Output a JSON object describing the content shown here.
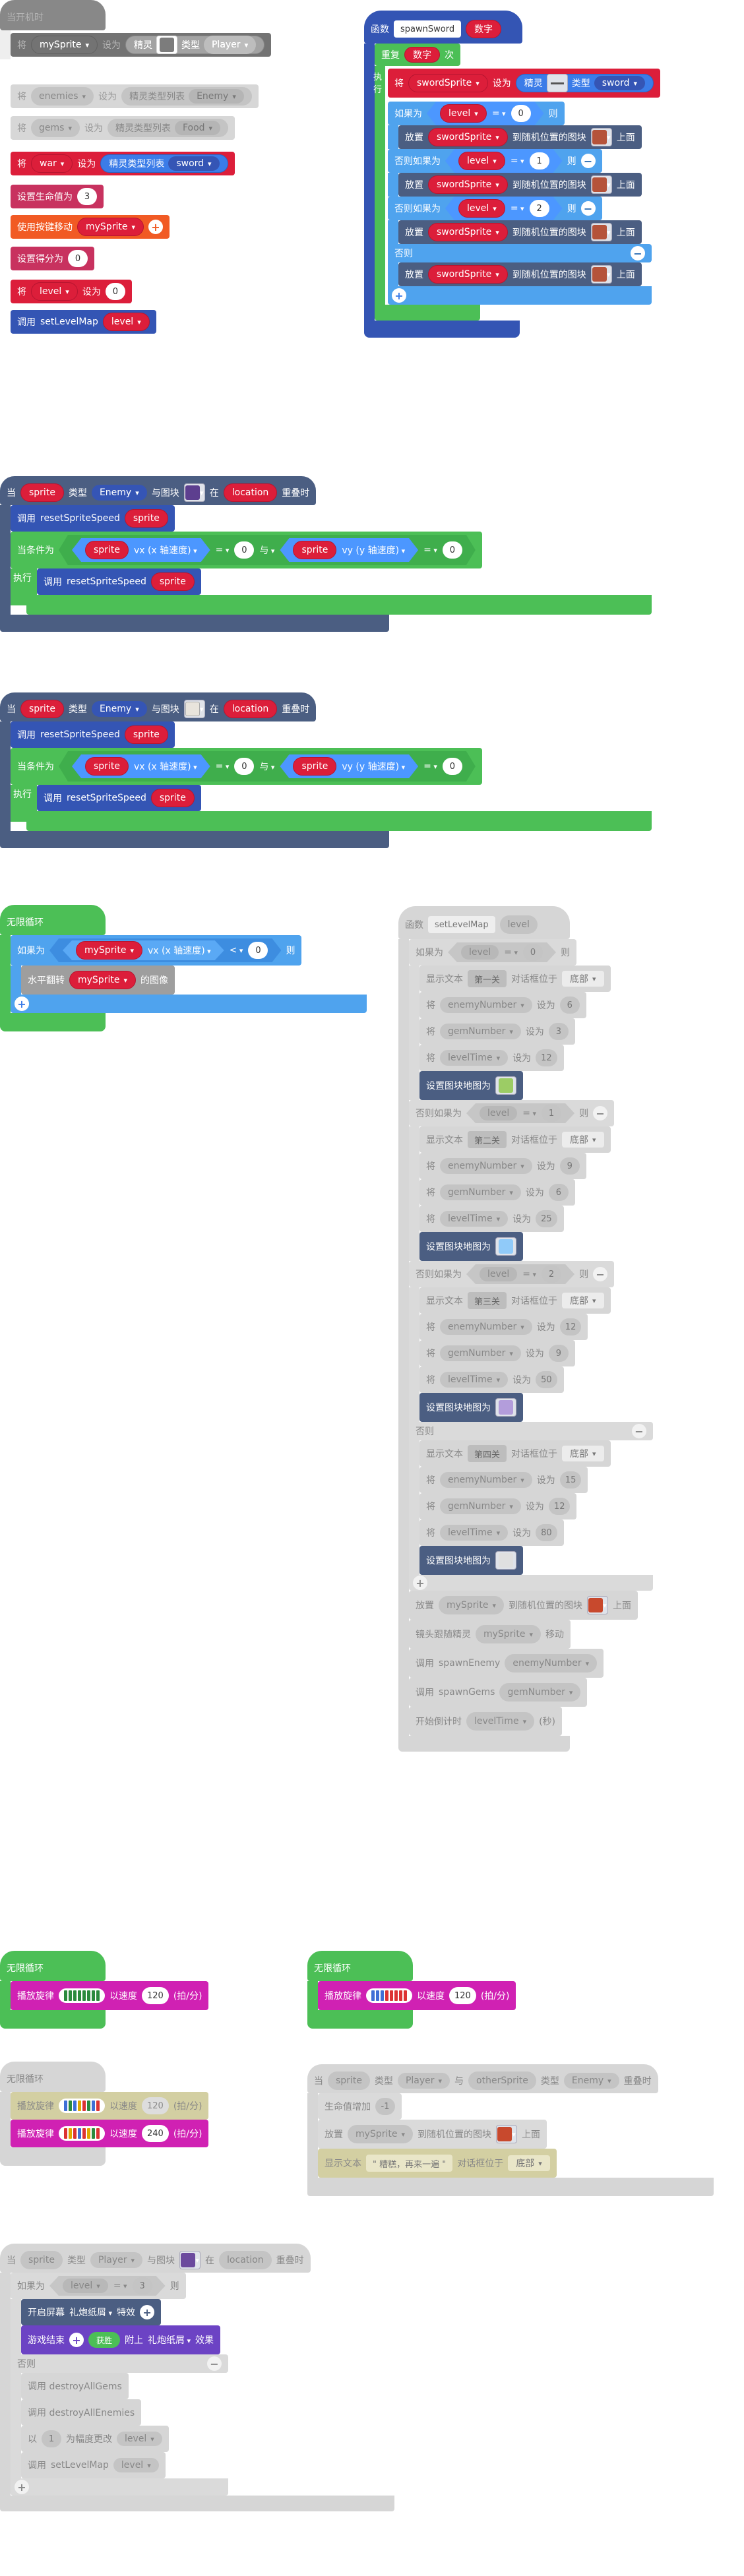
{
  "on_start": {
    "hat": "当开机时",
    "b1": {
      "set": "将",
      "var": "mySprite",
      "to": "设为",
      "sprite": "精灵",
      "type_lbl": "类型",
      "kind": "Player"
    },
    "b2": {
      "set": "将",
      "var": "enemies",
      "to": "设为",
      "list": "精灵类型列表",
      "kind": "Enemy"
    },
    "b3": {
      "set": "将",
      "var": "gems",
      "to": "设为",
      "list": "精灵类型列表",
      "kind": "Food"
    },
    "b4": {
      "set": "将",
      "var": "war",
      "to": "设为",
      "list": "精灵类型列表",
      "kind": "sword"
    },
    "b5": {
      "label": "设置生命值为",
      "value": "3"
    },
    "b6": {
      "label": "使用按键移动",
      "var": "mySprite"
    },
    "b7": {
      "label": "设置得分为",
      "value": "0"
    },
    "b8": {
      "set": "将",
      "var": "level",
      "to": "设为",
      "value": "0"
    },
    "b9": {
      "call": "调用",
      "fn": "setLevelMap",
      "arg": "level"
    }
  },
  "spawn_sword": {
    "hat_fn": "函数",
    "fn_name": "spawnSword",
    "param": "数字",
    "repeat": "重复",
    "repeat_arg": "数字",
    "times": "次",
    "do": "执行",
    "set": {
      "set": "将",
      "var": "swordSprite",
      "to": "设为",
      "sprite": "精灵",
      "type_lbl": "类型",
      "kind": "sword"
    },
    "if_lbl": "如果为",
    "then": "则",
    "elif": "否则如果为",
    "else": "否则",
    "lvl_var": "level",
    "eq": "=",
    "v0": "0",
    "v1": "1",
    "v2": "2",
    "place": {
      "lbl": "放置",
      "var": "swordSprite",
      "at": "到随机位置的图块",
      "top": "上面"
    }
  },
  "overlap1": {
    "when": "当",
    "sprite": "sprite",
    "type_lbl": "类型",
    "kind": "Enemy",
    "with_tile": "与图块",
    "at": "在",
    "loc": "location",
    "overlap": "重叠时",
    "call": "调用",
    "fn": "resetSpriteSpeed",
    "arg": "sprite",
    "while": "当条件为",
    "vx": "vx (x 轴速度)",
    "vy": "vy (y 轴速度)",
    "eq": "=",
    "zero": "0",
    "and": "与",
    "do": "执行"
  },
  "overlap2": {
    "when": "当",
    "sprite": "sprite",
    "type_lbl": "类型",
    "kind": "Enemy",
    "with_tile": "与图块",
    "at": "在",
    "loc": "location",
    "overlap": "重叠时",
    "call": "调用",
    "fn": "resetSpriteSpeed",
    "arg": "sprite",
    "while": "当条件为",
    "vx": "vx (x 轴速度)",
    "vy": "vy (y 轴速度)",
    "eq": "=",
    "zero": "0",
    "and": "与",
    "do": "执行"
  },
  "forever1": {
    "hat": "无限循环",
    "if_lbl": "如果为",
    "var": "mySprite",
    "vx": "vx (x 轴速度)",
    "lt": "<",
    "zero": "0",
    "then": "则",
    "flip": "水平翻转",
    "flip_var": "mySprite",
    "flip_tail": "的图像"
  },
  "set_level_map": {
    "fn": "函数",
    "name": "setLevelMap",
    "param": "level",
    "if_lbl": "如果为",
    "elif": "否则如果为",
    "else": "否则",
    "then": "则",
    "eq": "=",
    "show": "显示文本",
    "pos": "对话框位于",
    "pos_v": "底部",
    "set": "将",
    "to": "设为",
    "en": "enemyNumber",
    "gn": "gemNumber",
    "lt": "levelTime",
    "tilemap": "设置图块地图为",
    "sections": [
      {
        "cond": "0",
        "text": "第一关",
        "en": "6",
        "gn": "3",
        "lt": "12"
      },
      {
        "cond": "1",
        "text": "第二关",
        "en": "9",
        "gn": "6",
        "lt": "25"
      },
      {
        "cond": "2",
        "text": "第三关",
        "en": "12",
        "gn": "9",
        "lt": "50"
      },
      {
        "cond": "",
        "text": "第四关",
        "en": "15",
        "gn": "12",
        "lt": "80"
      }
    ],
    "place": "放置",
    "place_var": "mySprite",
    "place_at": "到随机位置的图块",
    "place_top": "上面",
    "cam": "镜头跟随精灵",
    "cam_var": "mySprite",
    "cam_tail": "移动",
    "call1": "调用",
    "call1_fn": "spawnEnemy",
    "call1_arg": "enemyNumber",
    "call2": "调用",
    "call2_fn": "spawnGems",
    "call2_arg": "gemNumber",
    "timer": "开始倒计时",
    "timer_var": "levelTime",
    "timer_tail": "(秒)"
  },
  "forever2": {
    "hat": "无限循环",
    "play": "播放旋律",
    "at": "以速度",
    "bpm": "120",
    "unit": "(拍/分)"
  },
  "forever3": {
    "hat": "无限循环",
    "play": "播放旋律",
    "at": "以速度",
    "bpm": "120",
    "unit": "(拍/分)"
  },
  "forever4": {
    "hat": "无限循环",
    "play": "播放旋律",
    "at": "以速度",
    "bpm1": "120",
    "bpm2": "240",
    "unit": "(拍/分)"
  },
  "overlap_sprites": {
    "when": "当",
    "sprite": "sprite",
    "type_lbl": "类型",
    "kind": "Player",
    "with": "与",
    "other": "otherSprite",
    "kind2": "Enemy",
    "overlap": "重叠时",
    "life": "生命值增加",
    "life_v": "-1",
    "place": "放置",
    "place_var": "mySprite",
    "place_at": "到随机位置的图块",
    "place_top": "上面",
    "show": "显示文本",
    "text": "\" 糟糕，再来一遍 \"",
    "pos": "对话框位于",
    "pos_v": "底部"
  },
  "overlap_tile": {
    "when": "当",
    "sprite": "sprite",
    "type_lbl": "类型",
    "kind": "Player",
    "with_tile": "与图块",
    "at": "在",
    "loc": "location",
    "overlap": "重叠时",
    "if_lbl": "如果为",
    "var": "level",
    "eq": "=",
    "val": "3",
    "then": "则",
    "open": "开启屏幕",
    "open_v": "礼炮纸屑",
    "open_tail": "特效",
    "over": "游戏结束",
    "win": "获胜",
    "attach": "附上",
    "attach_v": "礼炮纸屑",
    "eff": "效果",
    "else": "否则",
    "d1": "调用 destroyAllGems",
    "d2": "调用 destroyAllEnemies",
    "chg": "以",
    "chg_v": "1",
    "chg_tail": "为幅度更改",
    "chg_var": "level",
    "call": "调用",
    "call_fn": "setLevelMap",
    "call_arg": "level"
  },
  "colors": {
    "event": "#4b5e82",
    "sprite": "#4b6bbf",
    "var": "#dc1e3a",
    "info": "#c8325f",
    "control": "#f15a24",
    "loop": "#4cbf56",
    "logic": "#4fa3ee",
    "function": "#3455b4",
    "music": "#d021b3",
    "game": "#6c43c4"
  }
}
